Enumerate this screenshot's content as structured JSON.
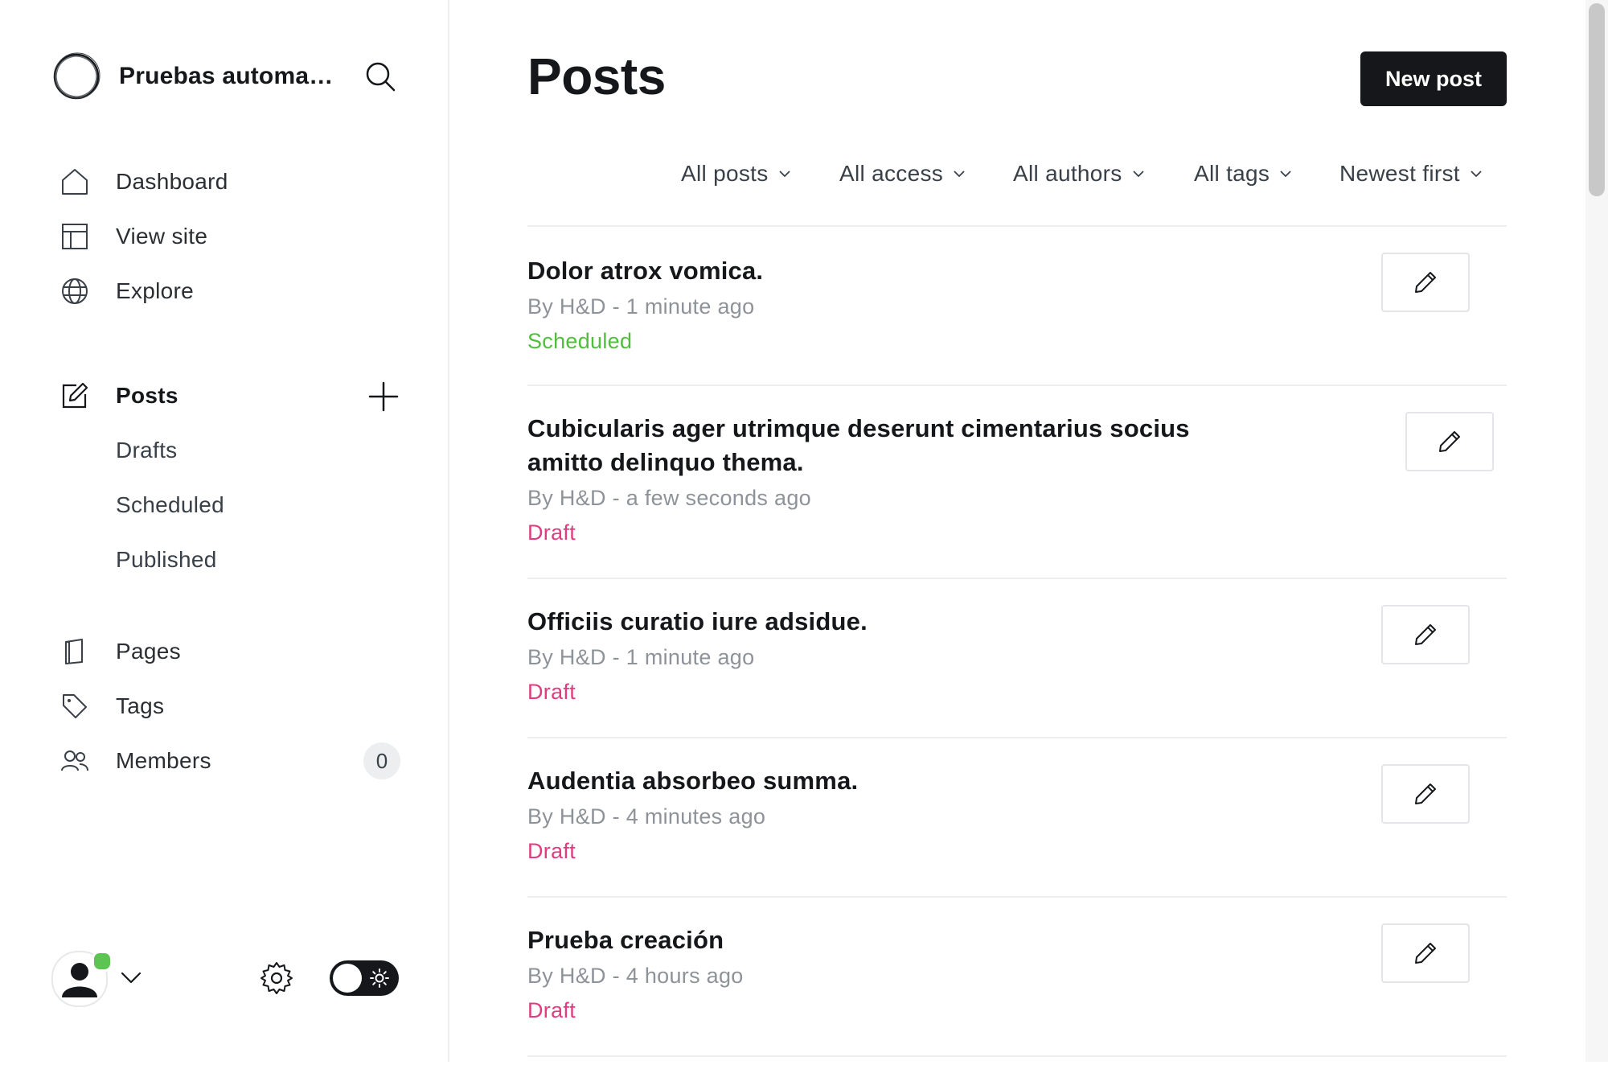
{
  "sidebar": {
    "site_name": "Pruebas automatizadas",
    "nav": [
      {
        "label": "Dashboard",
        "icon": "home-icon"
      },
      {
        "label": "View site",
        "icon": "layout-icon"
      },
      {
        "label": "Explore",
        "icon": "globe-icon"
      }
    ],
    "posts": {
      "label": "Posts",
      "icon": "pencil-square-icon",
      "subitems": [
        "Drafts",
        "Scheduled",
        "Published"
      ]
    },
    "secondary": [
      {
        "label": "Pages",
        "icon": "page-icon"
      },
      {
        "label": "Tags",
        "icon": "tag-icon"
      },
      {
        "label": "Members",
        "icon": "members-icon",
        "count": "0"
      }
    ],
    "user_online": true
  },
  "header": {
    "title": "Posts",
    "new_post_label": "New post"
  },
  "filters": [
    "All posts",
    "All access",
    "All authors",
    "All tags",
    "Newest first"
  ],
  "posts": [
    {
      "title": "Dolor atrox vomica.",
      "meta": "By H&D - 1 minute ago",
      "status": "Scheduled"
    },
    {
      "title": "Cubicularis ager utrimque deserunt cimentarius socius amitto delinquo thema.",
      "meta": "By H&D - a few seconds ago",
      "status": "Draft"
    },
    {
      "title": "Officiis curatio iure adsidue.",
      "meta": "By H&D - 1 minute ago",
      "status": "Draft"
    },
    {
      "title": "Audentia absorbeo summa.",
      "meta": "By H&D - 4 minutes ago",
      "status": "Draft"
    },
    {
      "title": "Prueba creación",
      "meta": "By H&D - 4 hours ago",
      "status": "Draft"
    }
  ],
  "colors": {
    "scheduled": "#4fbf3a",
    "draft": "#e13c7f",
    "primary_button": "#15171a"
  }
}
